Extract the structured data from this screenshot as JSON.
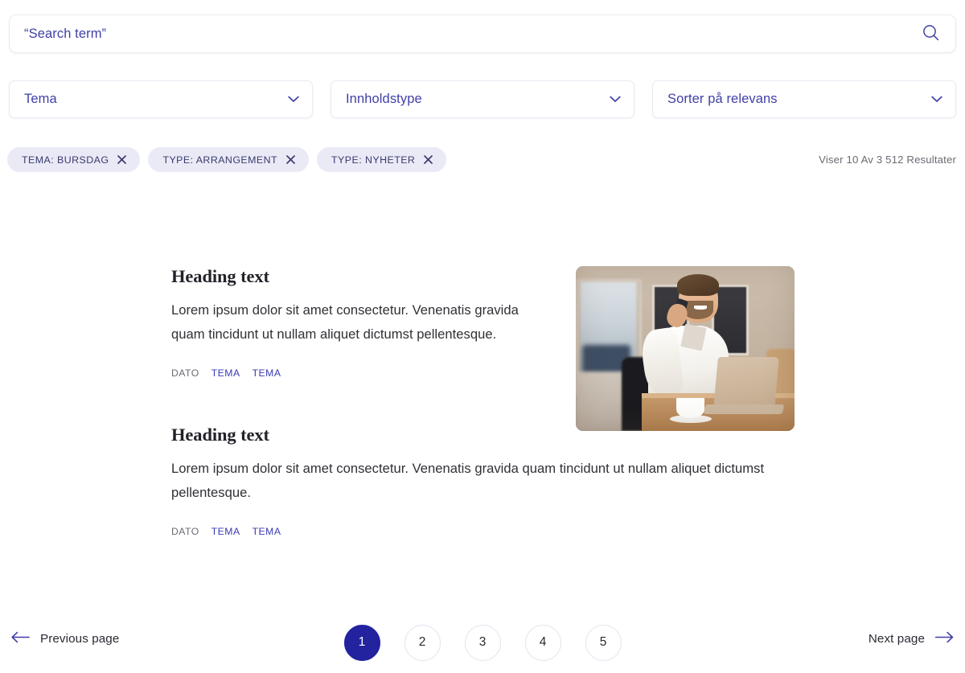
{
  "search": {
    "value": "“Search term”",
    "placeholder": "“Search term”",
    "icon": "search-icon"
  },
  "filters": {
    "selects": [
      {
        "label": "Tema",
        "icon": "chevron-down-icon"
      },
      {
        "label": "Innholdstype",
        "icon": "chevron-down-icon"
      },
      {
        "label": "Sorter på relevans",
        "icon": "chevron-down-icon"
      }
    ],
    "chips": [
      {
        "label": "TEMA: BURSDAG",
        "remove_icon": "close-icon"
      },
      {
        "label": "TYPE: ARRANGEMENT",
        "remove_icon": "close-icon"
      },
      {
        "label": "TYPE: NYHETER",
        "remove_icon": "close-icon"
      }
    ],
    "results_count": "Viser 10 Av 3 512 Resultater"
  },
  "results": [
    {
      "heading": "Heading text",
      "body": "Lorem ipsum dolor sit amet consectetur. Venenatis gravida quam tincidunt ut nullam aliquet dictumst pellentesque.",
      "meta": {
        "date": "DATO",
        "tags": [
          "TEMA",
          "TEMA"
        ]
      },
      "has_image": true,
      "image_alt": "Smiling man in white shirt talking on mobile phone at a desk with a laptop and coffee cup"
    },
    {
      "heading": "Heading text",
      "body": "Lorem ipsum dolor sit amet consectetur. Venenatis gravida quam tincidunt ut nullam aliquet dictumst pellentesque.",
      "meta": {
        "date": "DATO",
        "tags": [
          "TEMA",
          "TEMA"
        ]
      },
      "has_image": false
    }
  ],
  "pagination": {
    "previous_label": "Previous page",
    "previous_icon": "arrow-left-icon",
    "next_label": "Next page",
    "next_icon": "arrow-right-icon",
    "pages": [
      "1",
      "2",
      "3",
      "4",
      "5"
    ],
    "current_page": "1"
  },
  "colors": {
    "accent_purple": "#3f3fa8",
    "accent_blue": "#3838b4",
    "active_page": "#2323a0",
    "chip_bg": "#e9eaf6",
    "muted_text": "#6b6b74",
    "body_text": "#303036"
  }
}
